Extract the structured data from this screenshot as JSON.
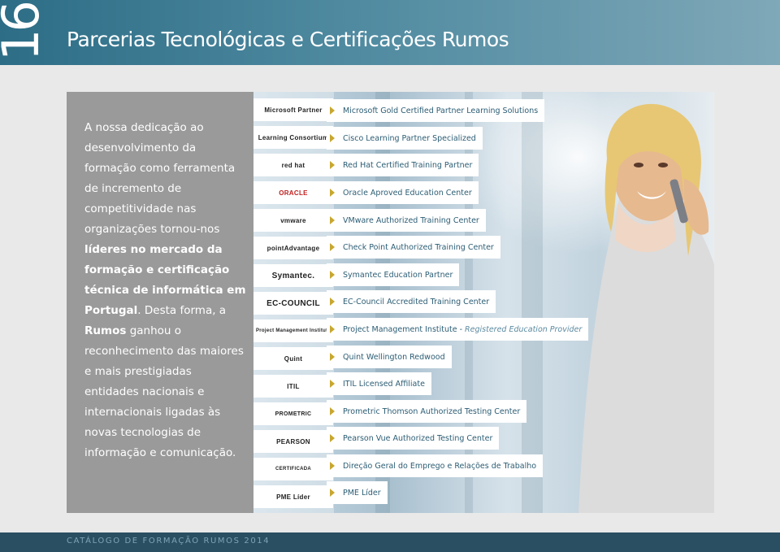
{
  "header": {
    "page_number": "16",
    "title": "Parcerias Tecnológicas e Certificações Rumos"
  },
  "intro": {
    "part1": "A nossa dedicação ao desenvolvimento da formação como ferramenta de incremento de competitividade nas organizações tornou-nos",
    "part2_bold": "líderes no mercado da formação e certificação técnica de informática em Portugal",
    "part3": ". Desta forma, a",
    "part4_bold": "Rumos",
    "part5": "ganhou o reconhecimento das maiores e mais prestigiadas entidades nacionais e internacionais ligadas às novas tecnologias de informação e comunicação."
  },
  "logos": [
    {
      "text": "Microsoft Partner"
    },
    {
      "text": "Learning Consortium"
    },
    {
      "text": "red hat"
    },
    {
      "text": "ORACLE"
    },
    {
      "text": "vmware"
    },
    {
      "text": "pointAdvantage"
    },
    {
      "text": "Symantec."
    },
    {
      "text": "EC-COUNCIL"
    },
    {
      "text": "Project Management Institute"
    },
    {
      "text": "Quint"
    },
    {
      "text": "ITIL"
    },
    {
      "text": "PROMETRIC"
    },
    {
      "text": "PEARSON"
    },
    {
      "text": "CERTIFICADA"
    },
    {
      "text": "PME Líder"
    }
  ],
  "partners": [
    {
      "label": "Microsoft Gold Certified Partner Learning Solutions"
    },
    {
      "label": "Cisco Learning Partner Specialized"
    },
    {
      "label": "Red Hat Certified Training Partner"
    },
    {
      "label": "Oracle Aproved Education Center"
    },
    {
      "label": "VMware Authorized Training Center"
    },
    {
      "label": "Check Point Authorized Training Center"
    },
    {
      "label": "Symantec Education Partner"
    },
    {
      "label": "EC-Council Accredited Training Center"
    },
    {
      "label": "Project Management Institute - ",
      "italic": "Registered Education Provider"
    },
    {
      "label": "Quint Wellington Redwood"
    },
    {
      "label": "ITIL Licensed Affiliate"
    },
    {
      "label": "Prometric Thomson Authorized Testing Center"
    },
    {
      "label": "Pearson Vue Authorized Testing Center"
    },
    {
      "label": "Direção Geral do Emprego e Relações de Trabalho"
    },
    {
      "label": "PME Líder"
    }
  ],
  "footer": {
    "text": "CATÁLOGO DE FORMAÇÃO RUMOS 2014"
  },
  "colors": {
    "header": "#2d6d86",
    "sidebar": "#9a9a9a",
    "partner_text": "#2c5d74",
    "arrow": "#c7a72f",
    "footer": "#2a4e62"
  }
}
